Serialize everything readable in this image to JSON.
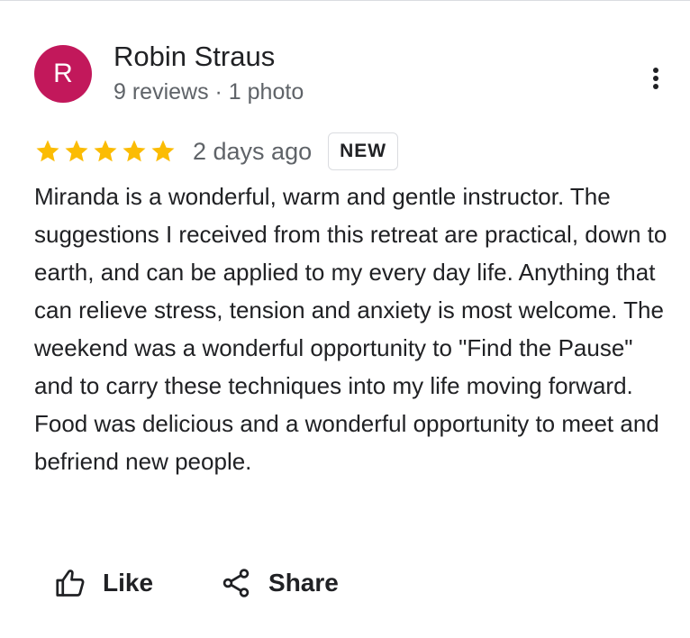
{
  "review": {
    "author": {
      "initial": "R",
      "name": "Robin Straus",
      "meta": "9 reviews · 1 photo",
      "avatar_color": "#c2185b"
    },
    "rating": 5,
    "rating_max": 5,
    "star_color": "#fbbc04",
    "date": "2 days ago",
    "badge": "NEW",
    "text": "Miranda is a wonderful, warm and gentle instructor. The suggestions I received from this retreat are practical, down to earth, and can be applied to my every day life. Anything that can relieve stress, tension and anxiety is most welcome. The weekend was a wonderful opportunity to \"Find the Pause\" and to carry these techniques into my life moving forward. Food was delicious and a wonderful opportunity to meet and befriend new people."
  },
  "actions": {
    "like_label": "Like",
    "like_icon": "thumb-up-icon",
    "share_label": "Share",
    "share_icon": "share-icon"
  },
  "menu_icon": "more-vert-icon"
}
